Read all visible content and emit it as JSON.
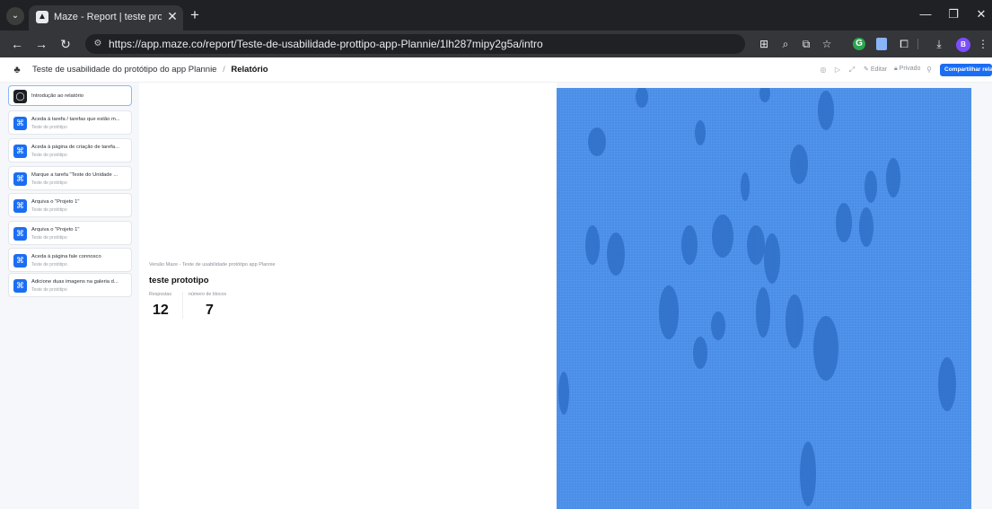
{
  "browser": {
    "tab_title": "Maze - Report | teste prototipo",
    "url": "https://app.maze.co/report/Teste-de-usabilidade-prottipo-app-Plannie/1lh287mipy2g5a/intro",
    "avatar_initial": "B"
  },
  "header": {
    "project": "Teste de usabilidade do protótipo do app Plannie",
    "separator": "/",
    "current": "Relatório",
    "edit_label": "Editar",
    "private_label": "Privado",
    "share_label": "Compartilhar relatório"
  },
  "sidebar": {
    "items": [
      {
        "title": "Introdução ao relatório",
        "subtitle": ""
      },
      {
        "title": "Aceda à tarefa / tarefas que estão m...",
        "subtitle": "Teste de protótipo"
      },
      {
        "title": "Aceda à página de criação de tarefa...",
        "subtitle": "Teste de protótipo"
      },
      {
        "title": "Marque a tarefa \"Teste do Unidade ...",
        "subtitle": "Teste de protótipo"
      },
      {
        "title": "Arquiva o \"Projeto 1\"",
        "subtitle": "Teste de protótipo"
      },
      {
        "title": "Arquiva o \"Projeto 1\"",
        "subtitle": "Teste de protótipo"
      },
      {
        "title": "Aceda à página fale connosco",
        "subtitle": "Teste de protótipo"
      },
      {
        "title": "Adicione duas imagens na galeria d...",
        "subtitle": "Teste de protótipo"
      }
    ]
  },
  "intro": {
    "version_line": "Versão Maze - Teste de usabilidade protótipo app Plannie",
    "maze_title": "teste prototipo",
    "stats": [
      {
        "label": "Respostas",
        "value": "12"
      },
      {
        "label": "número de blocos",
        "value": "7"
      }
    ]
  },
  "colors": {
    "accent": "#1b6ef3",
    "hero": "#4a8ee8"
  }
}
